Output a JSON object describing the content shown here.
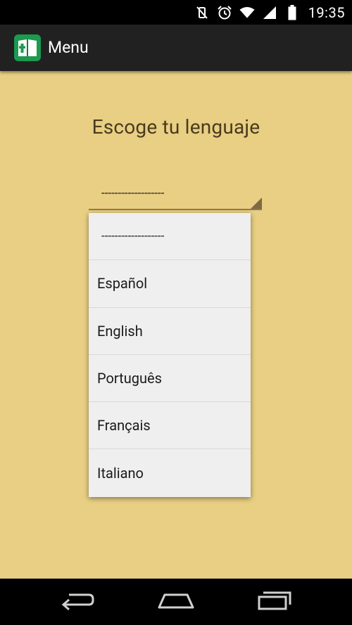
{
  "status_bar": {
    "time": "19:35",
    "icons": [
      "vibrate-mute-icon",
      "alarm-icon",
      "wifi-icon",
      "signal-icon",
      "battery-icon"
    ]
  },
  "action_bar": {
    "title": "Menu",
    "app_icon": "book-cross-icon"
  },
  "content": {
    "heading": "Escoge tu lenguaje",
    "spinner": {
      "selected_value": "-------------------"
    },
    "dropdown": {
      "options": [
        "-------------------",
        "Español",
        "English",
        "Português",
        "Français",
        "Italiano"
      ]
    }
  },
  "nav_bar": {
    "buttons": [
      "back-icon",
      "home-icon",
      "recents-icon"
    ]
  },
  "colors": {
    "background": "#e8cf83",
    "action_bar": "#212121",
    "app_icon_bg": "#1b9a50",
    "dropdown_bg": "#efefef",
    "heading_text": "#4a3b1d"
  }
}
